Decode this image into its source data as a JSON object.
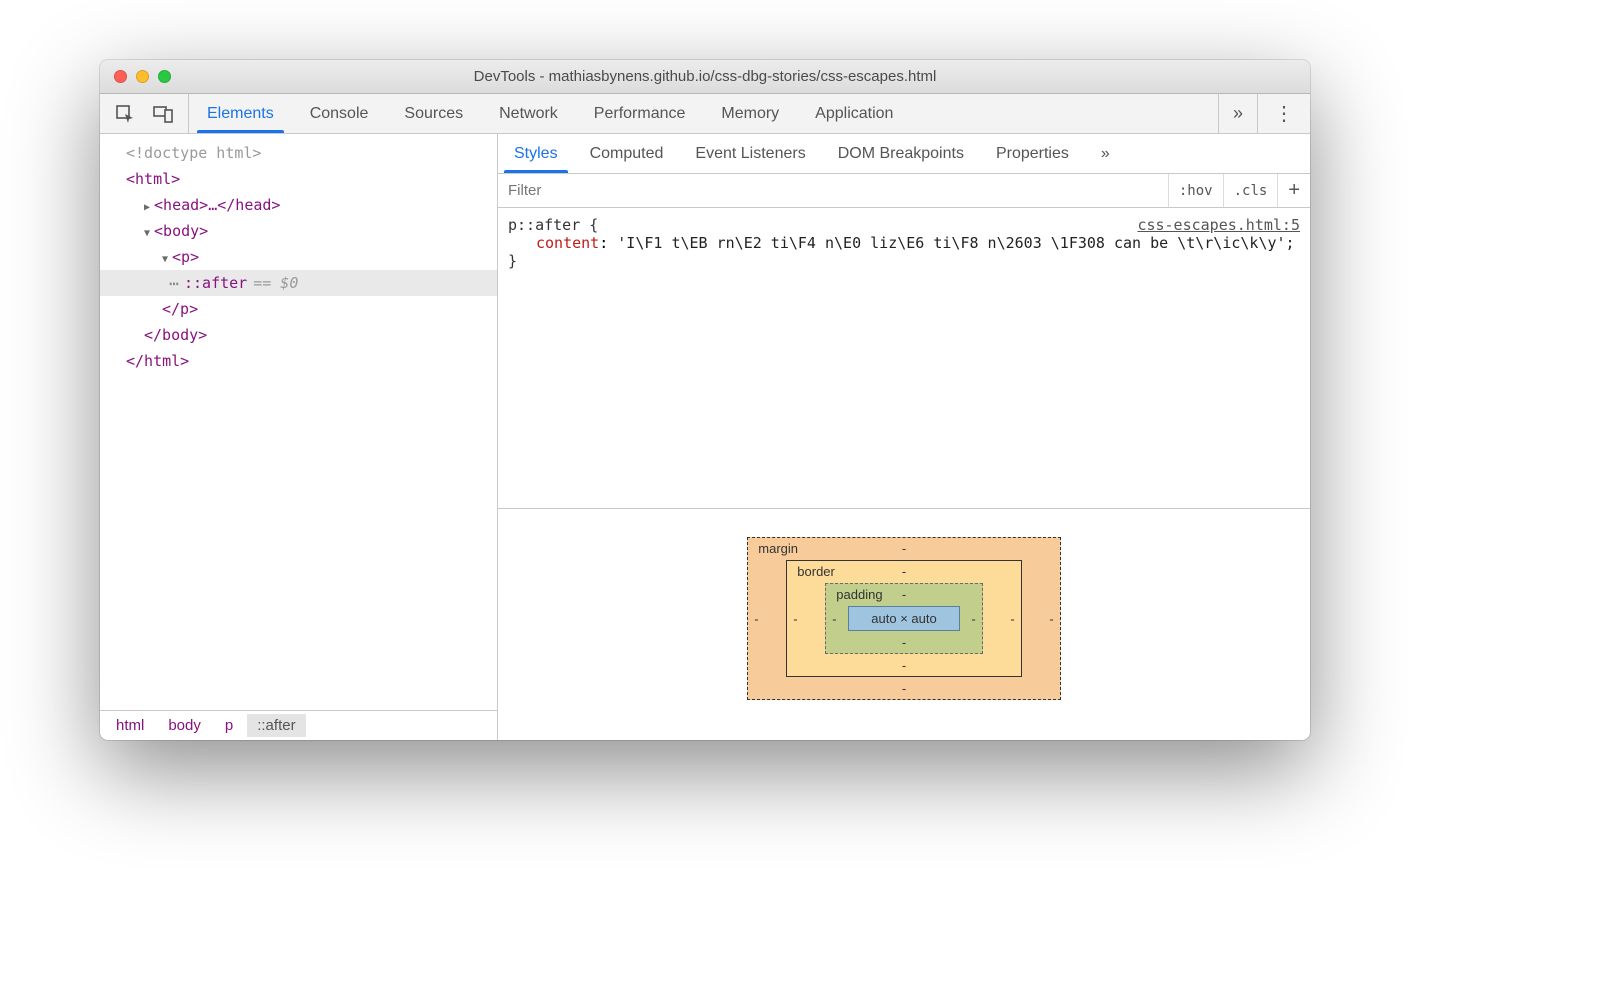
{
  "window": {
    "title": "DevTools - mathiasbynens.github.io/css-dbg-stories/css-escapes.html"
  },
  "mainTabs": {
    "items": [
      "Elements",
      "Console",
      "Sources",
      "Network",
      "Performance",
      "Memory",
      "Application"
    ],
    "overflow": "»"
  },
  "dom": {
    "doctype": "<!doctype html>",
    "htmlOpen": "<html>",
    "headCollapsed": "<head>…</head>",
    "bodyOpen": "<body>",
    "pOpen": "<p>",
    "after": "::after",
    "eqZero": "== $0",
    "pClose": "</p>",
    "bodyClose": "</body>",
    "htmlClose": "</html>"
  },
  "breadcrumbs": [
    "html",
    "body",
    "p",
    "::after"
  ],
  "subTabs": {
    "items": [
      "Styles",
      "Computed",
      "Event Listeners",
      "DOM Breakpoints",
      "Properties"
    ],
    "overflow": "»"
  },
  "filter": {
    "placeholder": "Filter",
    "hov": ":hov",
    "cls": ".cls",
    "plus": "+"
  },
  "rule": {
    "selector": "p::after {",
    "source": "css-escapes.html:5",
    "propName": "content",
    "propValue": "'I\\F1 t\\EB rn\\E2 ti\\F4 n\\E0 liz\\E6 ti\\F8 n\\2603 \\1F308 can be \\t\\r\\ic\\k\\y';",
    "close": "}"
  },
  "boxModel": {
    "marginLabel": "margin",
    "borderLabel": "border",
    "paddingLabel": "padding",
    "content": "auto × auto",
    "dash": "-"
  }
}
